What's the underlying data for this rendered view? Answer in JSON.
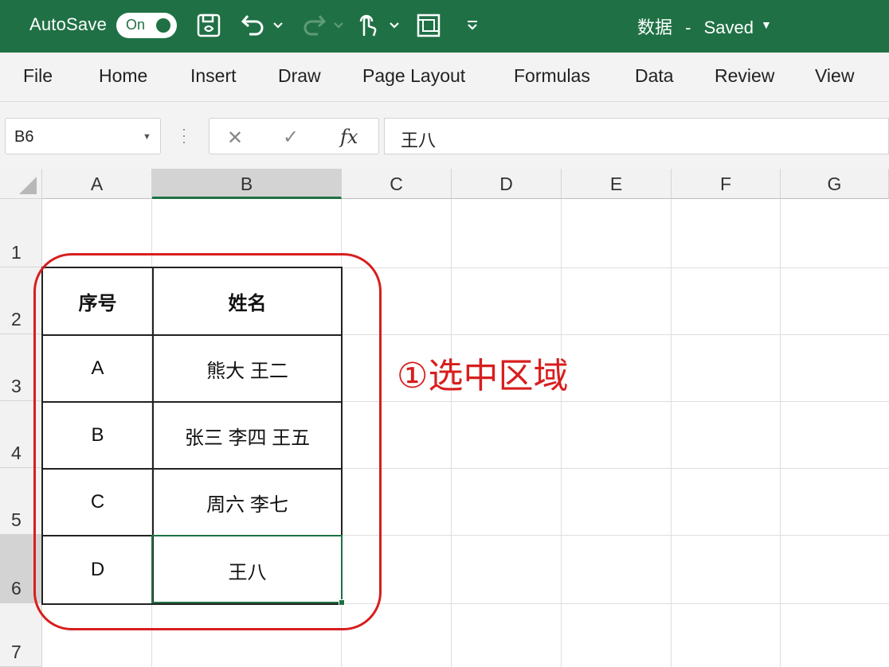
{
  "title_bar": {
    "autosave_label": "AutoSave",
    "autosave_state": "On",
    "document_name": "数据",
    "separator": "-",
    "save_status": "Saved"
  },
  "menu": [
    "File",
    "Home",
    "Insert",
    "Draw",
    "Page Layout",
    "Formulas",
    "Data",
    "Review",
    "View"
  ],
  "formula_bar": {
    "name_box": "B6",
    "fx_label": "fx",
    "formula_value": "王八"
  },
  "columns": [
    "A",
    "B",
    "C",
    "D",
    "E",
    "F",
    "G"
  ],
  "selected_column": "B",
  "rows": [
    "1",
    "2",
    "3",
    "4",
    "5",
    "6",
    "7"
  ],
  "selected_row": "6",
  "table": {
    "header": [
      "序号",
      "姓名"
    ],
    "rows": [
      [
        "A",
        "熊大 王二"
      ],
      [
        "B",
        "张三 李四 王五"
      ],
      [
        "C",
        "周六 李七"
      ],
      [
        "D",
        "王八"
      ]
    ]
  },
  "annotation": "①选中区域",
  "colors": {
    "excel_green": "#1f7145",
    "annotation_red": "#d81e1e"
  },
  "icons": [
    "save-icon",
    "undo-icon",
    "redo-icon",
    "touch-mode-icon",
    "page-setup-icon",
    "customize-toolbar-icon"
  ]
}
